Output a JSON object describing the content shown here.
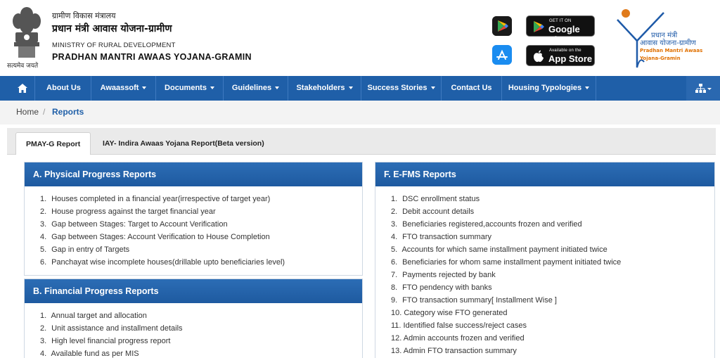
{
  "header": {
    "emblem_caption": "सत्यमेव जयते",
    "ministry_hi": "ग्रामीण विकास मंत्रालय",
    "scheme_hi": "प्रधान मंत्री आवास योजना-ग्रामीण",
    "ministry_en": "MINISTRY OF RURAL DEVELOPMENT",
    "scheme_en": "PRADHAN MANTRI AWAAS YOJANA-GRAMIN",
    "google_play_small": "GET IT ON",
    "google_play_big": "Google Play",
    "app_store_small": "Available on the",
    "app_store_big": "App Store",
    "logo_line1": "प्रधान मंत्री",
    "logo_line2": "आवास योजना-ग्रामीण",
    "logo_line3": "Pradhan Mantri Awaas Yojana-Gramin"
  },
  "nav": {
    "home_icon": "home-icon",
    "items": [
      {
        "label": "About Us",
        "dropdown": false
      },
      {
        "label": "Awaassoft",
        "dropdown": true
      },
      {
        "label": "Documents",
        "dropdown": true
      },
      {
        "label": "Guidelines",
        "dropdown": true
      },
      {
        "label": "Stakeholders",
        "dropdown": true
      },
      {
        "label": "Success Stories",
        "dropdown": true
      },
      {
        "label": "Contact Us",
        "dropdown": false
      },
      {
        "label": "Housing Typologies",
        "dropdown": true
      }
    ],
    "sitemap_icon": "sitemap-icon"
  },
  "breadcrumb": {
    "home": "Home",
    "separator": "/",
    "current": "Reports"
  },
  "tabs": [
    {
      "label": "PMAY-G Report",
      "active": true
    },
    {
      "label": "IAY- Indira Awaas Yojana Report(Beta version)",
      "active": false
    }
  ],
  "panels": {
    "physical": {
      "title": "A. Physical Progress Reports",
      "items": [
        {
          "num": "1.",
          "text": "Houses completed in a financial year(irrespective of target year)"
        },
        {
          "num": "2.",
          "text": "House progress against the target financial year"
        },
        {
          "num": "3.",
          "text": "Gap between Stages: Target to Account Verification"
        },
        {
          "num": "4.",
          "text": "Gap between Stages: Account Verification to House Completion"
        },
        {
          "num": "5.",
          "text": "Gap in entry of Targets"
        },
        {
          "num": "6.",
          "text": "Panchayat wise incomplete houses(drillable upto beneficiaries level)"
        }
      ]
    },
    "financial": {
      "title": "B. Financial Progress Reports",
      "items": [
        {
          "num": "1.",
          "text": "Annual target and allocation"
        },
        {
          "num": "2.",
          "text": "Unit assistance and installment details"
        },
        {
          "num": "3.",
          "text": "High level financial progress report"
        },
        {
          "num": "4.",
          "text": "Available fund as per MIS"
        }
      ]
    },
    "efms": {
      "title": "F. E-FMS Reports",
      "items": [
        {
          "num": "1.",
          "text": "DSC enrollment status"
        },
        {
          "num": "2.",
          "text": "Debit account details"
        },
        {
          "num": "3.",
          "text": "Beneficiaries registered,accounts frozen and verified"
        },
        {
          "num": "4.",
          "text": "FTO transaction summary"
        },
        {
          "num": "5.",
          "text": "Accounts for which same installment payment initiated twice"
        },
        {
          "num": "6.",
          "text": "Beneficiaries for whom same installment payment initiated twice"
        },
        {
          "num": "7.",
          "text": "Payments rejected by bank"
        },
        {
          "num": "8.",
          "text": "FTO pendency with banks"
        },
        {
          "num": "9.",
          "text": "FTO transaction summary[ Installment Wise ]"
        },
        {
          "num": "10.",
          "text": "Category wise FTO generated"
        },
        {
          "num": "11.",
          "text": "Identified false success/reject cases"
        },
        {
          "num": "12.",
          "text": "Admin accounts frozen and verified"
        },
        {
          "num": "13.",
          "text": "Admin FTO transaction summary"
        }
      ]
    }
  },
  "colors": {
    "nav_blue": "#1f5fa8",
    "panel_header": "#2c6db5",
    "breadcrumb_active": "#1f5fa8"
  }
}
